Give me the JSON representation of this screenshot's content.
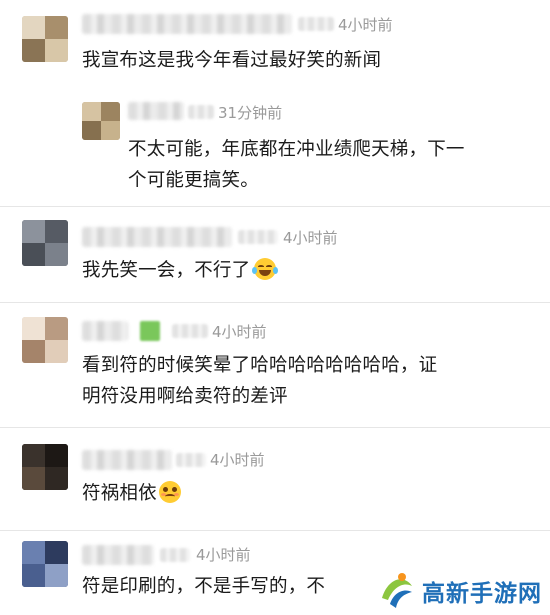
{
  "comments": [
    {
      "time": "4小时前",
      "text": "我宣布这是我今年看过最好笑的新闻"
    },
    {
      "time": "31分钟前",
      "text_lines": [
        "不太可能，年底都在冲业绩爬天梯，下一",
        "个可能更搞笑。"
      ]
    },
    {
      "time": "4小时前",
      "text": "我先笑一会，不行了",
      "emoji": "tears-of-joy-emoji"
    },
    {
      "time": "4小时前",
      "text_lines": [
        "看到符的时候笑晕了哈哈哈哈哈哈哈哈，证",
        "明符没用啊给卖符的差评"
      ]
    },
    {
      "time": "4小时前",
      "text": "符祸相依",
      "emoji": "zany-face-emoji"
    },
    {
      "time": "4小时前",
      "text": "符是印刷的，不是手写的，不"
    }
  ],
  "watermark": {
    "text": "高新手游网",
    "icon": "runner-logo-icon",
    "color": "#1f6fb8"
  },
  "colors": {
    "timestamp": "#9a9a9a",
    "divider": "#e6e6e6",
    "body_text": "#1b1b1b"
  }
}
